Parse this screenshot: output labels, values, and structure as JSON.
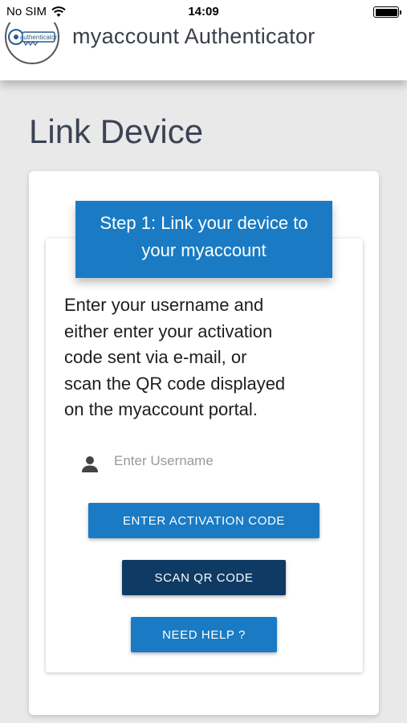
{
  "status_bar": {
    "carrier": "No SIM",
    "time": "14:09"
  },
  "header": {
    "logo_text": "authenticator",
    "title": "myaccount Authenticator"
  },
  "page": {
    "title": "Link Device"
  },
  "step": {
    "line1": "Step 1: Link your device to",
    "line2": "your myaccount"
  },
  "instructions": {
    "lines": [
      "Enter your username and",
      "either enter your activation",
      "code sent via e-mail, or",
      "scan the QR code displayed",
      "on the myaccount portal."
    ]
  },
  "username": {
    "placeholder": "Enter Username",
    "value": ""
  },
  "buttons": {
    "activation": "ENTER ACTIVATION CODE",
    "scan_qr": "SCAN QR CODE",
    "help": "NEED HELP ?"
  },
  "colors": {
    "primary": "#1a7bc4",
    "dark": "#0f3a64",
    "title": "#3b4354"
  }
}
